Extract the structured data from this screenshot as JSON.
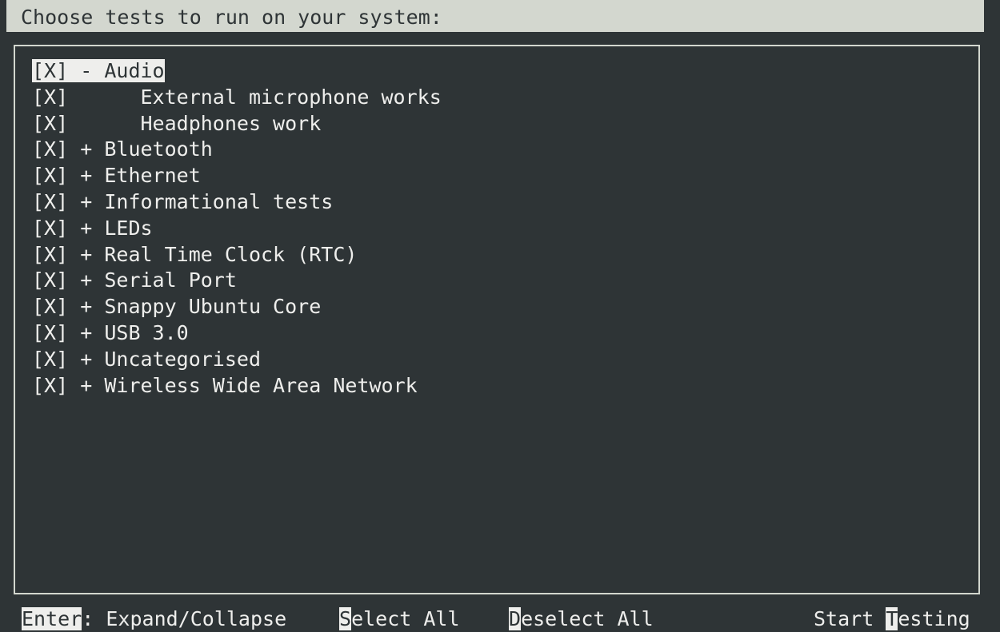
{
  "window": {
    "title": "Choose tests to run on your system:"
  },
  "test_list": [
    {
      "checkbox": "[X]",
      "toggle": "-",
      "label": "Audio",
      "indent": 0,
      "focused": true
    },
    {
      "checkbox": "[X]",
      "toggle": "",
      "label": "External microphone works",
      "indent": 1,
      "focused": false
    },
    {
      "checkbox": "[X]",
      "toggle": "",
      "label": "Headphones work",
      "indent": 1,
      "focused": false
    },
    {
      "checkbox": "[X]",
      "toggle": "+",
      "label": "Bluetooth",
      "indent": 0,
      "focused": false
    },
    {
      "checkbox": "[X]",
      "toggle": "+",
      "label": "Ethernet",
      "indent": 0,
      "focused": false
    },
    {
      "checkbox": "[X]",
      "toggle": "+",
      "label": "Informational tests",
      "indent": 0,
      "focused": false
    },
    {
      "checkbox": "[X]",
      "toggle": "+",
      "label": "LEDs",
      "indent": 0,
      "focused": false
    },
    {
      "checkbox": "[X]",
      "toggle": "+",
      "label": "Real Time Clock (RTC)",
      "indent": 0,
      "focused": false
    },
    {
      "checkbox": "[X]",
      "toggle": "+",
      "label": "Serial Port",
      "indent": 0,
      "focused": false
    },
    {
      "checkbox": "[X]",
      "toggle": "+",
      "label": "Snappy Ubuntu Core",
      "indent": 0,
      "focused": false
    },
    {
      "checkbox": "[X]",
      "toggle": "+",
      "label": "USB 3.0",
      "indent": 0,
      "focused": false
    },
    {
      "checkbox": "[X]",
      "toggle": "+",
      "label": "Uncategorised",
      "indent": 0,
      "focused": false
    },
    {
      "checkbox": "[X]",
      "toggle": "+",
      "label": "Wireless Wide Area Network",
      "indent": 0,
      "focused": false
    }
  ],
  "footer": {
    "enter": {
      "key": "Enter",
      "rest": ": Expand/Collapse"
    },
    "select_all": {
      "key": "S",
      "rest": "elect All"
    },
    "deselect_all": {
      "key": "D",
      "rest": "eselect All"
    },
    "start_testing": {
      "before": "Start ",
      "key": "T",
      "rest": "esting"
    }
  },
  "colors": {
    "background": "#2e3436",
    "foreground": "#eeeeec",
    "title_bar": "#d3d7cf"
  }
}
